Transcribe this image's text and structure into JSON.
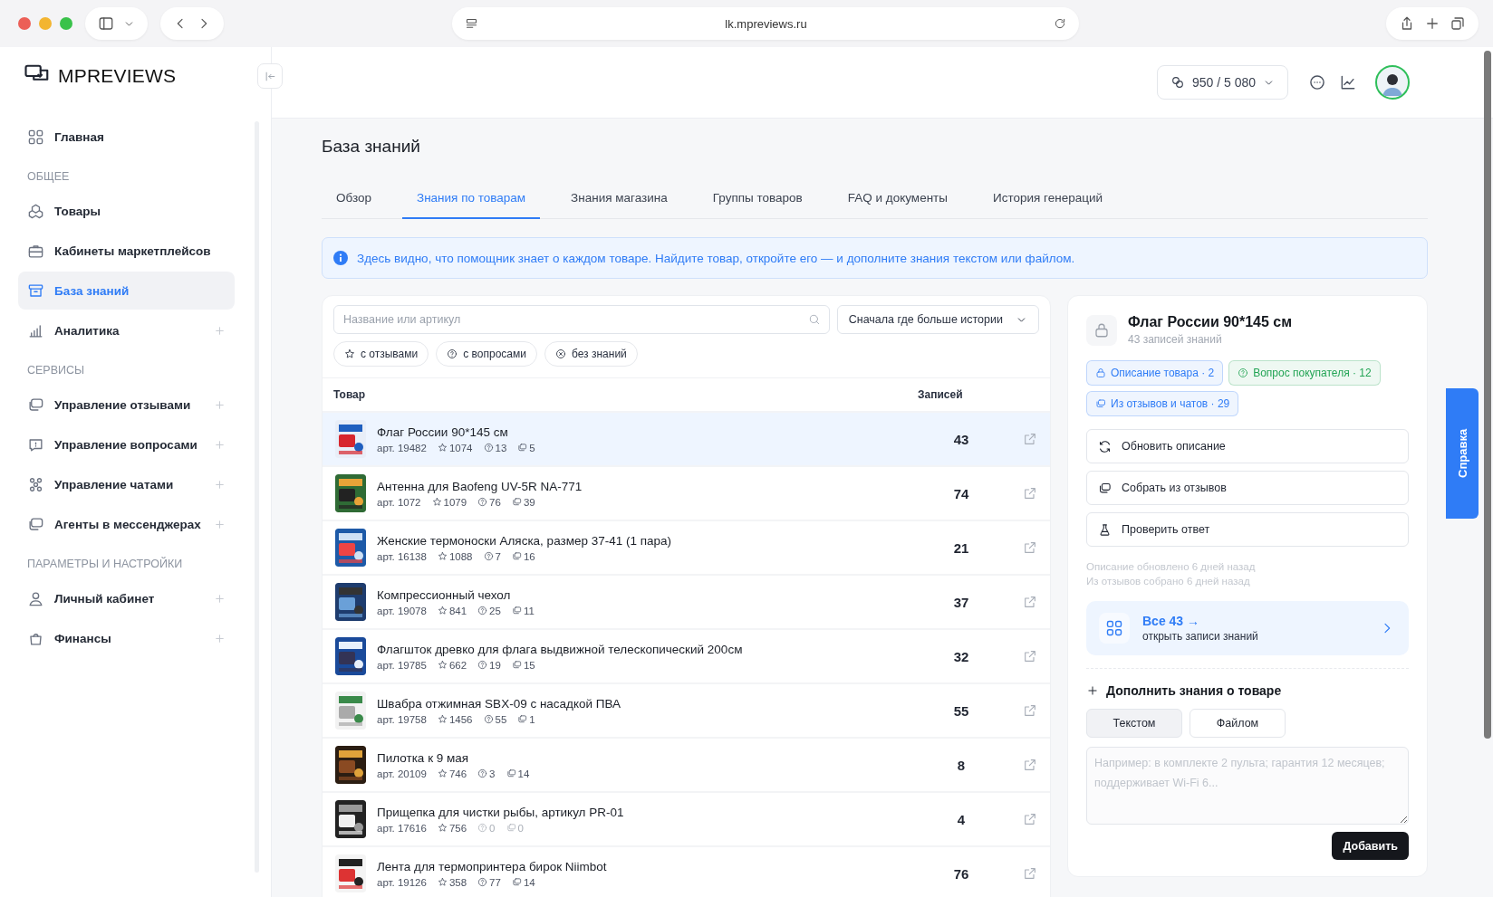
{
  "browser": {
    "url": "lk.mpreviews.ru"
  },
  "sidebar": {
    "logo": "MPREVIEWS",
    "sections": [
      {
        "items": [
          {
            "label": "Главная",
            "selected": false,
            "expandable": false
          }
        ]
      },
      {
        "heading": "ОБЩЕЕ",
        "items": [
          {
            "label": "Товары",
            "selected": false,
            "expandable": false
          },
          {
            "label": "Кабинеты маркетплейсов",
            "selected": false,
            "expandable": false
          },
          {
            "label": "База знаний",
            "selected": true,
            "expandable": false
          },
          {
            "label": "Аналитика",
            "selected": false,
            "expandable": true
          }
        ]
      },
      {
        "heading": "СЕРВИСЫ",
        "items": [
          {
            "label": "Управление отзывами",
            "selected": false,
            "expandable": true
          },
          {
            "label": "Управление вопросами",
            "selected": false,
            "expandable": true
          },
          {
            "label": "Управление чатами",
            "selected": false,
            "expandable": true
          },
          {
            "label": "Агенты в мессенджерах",
            "selected": false,
            "expandable": true
          }
        ]
      },
      {
        "heading": "ПАРАМЕТРЫ И НАСТРОЙКИ",
        "items": [
          {
            "label": "Личный кабинет",
            "selected": false,
            "expandable": true
          },
          {
            "label": "Финансы",
            "selected": false,
            "expandable": true
          }
        ]
      }
    ]
  },
  "header": {
    "credits": "950 / 5 080"
  },
  "page": {
    "title": "База знаний",
    "tabs": [
      {
        "label": "Обзор",
        "selected": false
      },
      {
        "label": "Знания по товарам",
        "selected": true
      },
      {
        "label": "Знания магазина",
        "selected": false
      },
      {
        "label": "Группы товаров",
        "selected": false
      },
      {
        "label": "FAQ и документы",
        "selected": false
      },
      {
        "label": "История генераций",
        "selected": false
      }
    ],
    "info": "Здесь видно, что помощник знает о каждом товаре. Найдите товар, откройте его — и дополните знания текстом или файлом."
  },
  "catalog": {
    "search": {
      "placeholder": "Название или артикул"
    },
    "sort": "Сначала где больше истории",
    "filters": [
      "с отзывами",
      "с вопросами",
      "без знаний"
    ],
    "columns": [
      "Товар",
      "Записей"
    ],
    "rows": [
      {
        "name": "Флаг России 90*145 см",
        "article": "арт. 19482",
        "stats": [
          {
            "kind": "reviews",
            "value": "1074",
            "dimmed": false
          },
          {
            "kind": "questions",
            "value": "13",
            "dimmed": false
          },
          {
            "kind": "chats",
            "value": "5",
            "dimmed": false
          }
        ],
        "count": "43",
        "selected": true
      },
      {
        "name": "Антенна для Baofeng UV-5R NA-771",
        "article": "арт. 1072",
        "stats": [
          {
            "kind": "reviews",
            "value": "1079",
            "dimmed": false
          },
          {
            "kind": "questions",
            "value": "76",
            "dimmed": false
          },
          {
            "kind": "chats",
            "value": "39",
            "dimmed": false
          }
        ],
        "count": "74",
        "selected": false
      },
      {
        "name": "Женские термоноски Аляска, размер 37-41 (1 пара)",
        "article": "арт. 16138",
        "stats": [
          {
            "kind": "reviews",
            "value": "1088",
            "dimmed": false
          },
          {
            "kind": "questions",
            "value": "7",
            "dimmed": false
          },
          {
            "kind": "chats",
            "value": "16",
            "dimmed": false
          }
        ],
        "count": "21",
        "selected": false
      },
      {
        "name": "Компрессионный чехол",
        "article": "арт. 19078",
        "stats": [
          {
            "kind": "reviews",
            "value": "841",
            "dimmed": false
          },
          {
            "kind": "questions",
            "value": "25",
            "dimmed": false
          },
          {
            "kind": "chats",
            "value": "11",
            "dimmed": false
          }
        ],
        "count": "37",
        "selected": false
      },
      {
        "name": "Флагшток древко для флага выдвижной телескопический 200см",
        "article": "арт. 19785",
        "stats": [
          {
            "kind": "reviews",
            "value": "662",
            "dimmed": false
          },
          {
            "kind": "questions",
            "value": "19",
            "dimmed": false
          },
          {
            "kind": "chats",
            "value": "15",
            "dimmed": false
          }
        ],
        "count": "32",
        "selected": false
      },
      {
        "name": "Швабра отжимная SBX-09 с насадкой ПВА",
        "article": "арт. 19758",
        "stats": [
          {
            "kind": "reviews",
            "value": "1456",
            "dimmed": false
          },
          {
            "kind": "questions",
            "value": "55",
            "dimmed": false
          },
          {
            "kind": "chats",
            "value": "1",
            "dimmed": false
          }
        ],
        "count": "55",
        "selected": false
      },
      {
        "name": "Пилотка к 9 мая",
        "article": "арт. 20109",
        "stats": [
          {
            "kind": "reviews",
            "value": "746",
            "dimmed": false
          },
          {
            "kind": "questions",
            "value": "3",
            "dimmed": false
          },
          {
            "kind": "chats",
            "value": "14",
            "dimmed": false
          }
        ],
        "count": "8",
        "selected": false
      },
      {
        "name": "Прищепка для чистки рыбы, артикул PR-01",
        "article": "арт. 17616",
        "stats": [
          {
            "kind": "reviews",
            "value": "756",
            "dimmed": false
          },
          {
            "kind": "questions",
            "value": "0",
            "dimmed": true
          },
          {
            "kind": "chats",
            "value": "0",
            "dimmed": true
          }
        ],
        "count": "4",
        "selected": false
      },
      {
        "name": "Лента для термопринтера бирок Niimbot",
        "article": "арт. 19126",
        "stats": [
          {
            "kind": "reviews",
            "value": "358",
            "dimmed": false
          },
          {
            "kind": "questions",
            "value": "77",
            "dimmed": false
          },
          {
            "kind": "chats",
            "value": "14",
            "dimmed": false
          }
        ],
        "count": "76",
        "selected": false
      }
    ]
  },
  "detail": {
    "title": "Флаг России 90*145 см",
    "subtitle": "43 записей знаний",
    "tags": [
      {
        "kind": "description",
        "label": "Описание товара · 2",
        "color": "#2f7cf6"
      },
      {
        "kind": "questions",
        "label": "Вопрос покупателя · 12",
        "color": "#23a455"
      },
      {
        "kind": "chats",
        "label": "Из отзывов и чатов · 29",
        "color": "#2f7cf6"
      }
    ],
    "actions": [
      "Обновить описание",
      "Собрать из отзывов",
      "Проверить ответ"
    ],
    "notes": [
      "Описание обновлено 6 дней назад",
      "Из отзывов собрано 6 дней назад"
    ],
    "all_link": {
      "title": "Все 43 →",
      "subtitle": "открыть записи знаний"
    },
    "add": {
      "title": "Дополнить знания о товаре",
      "modes": [
        {
          "label": "Текстом",
          "selected": true
        },
        {
          "label": "Файлом",
          "selected": false
        }
      ],
      "placeholder": "Например: в комплекте 2 пульта; гарантия 12 месяцев; поддерживает Wi-Fi 6...",
      "button": "Добавить"
    }
  },
  "help_tab": "Справка"
}
